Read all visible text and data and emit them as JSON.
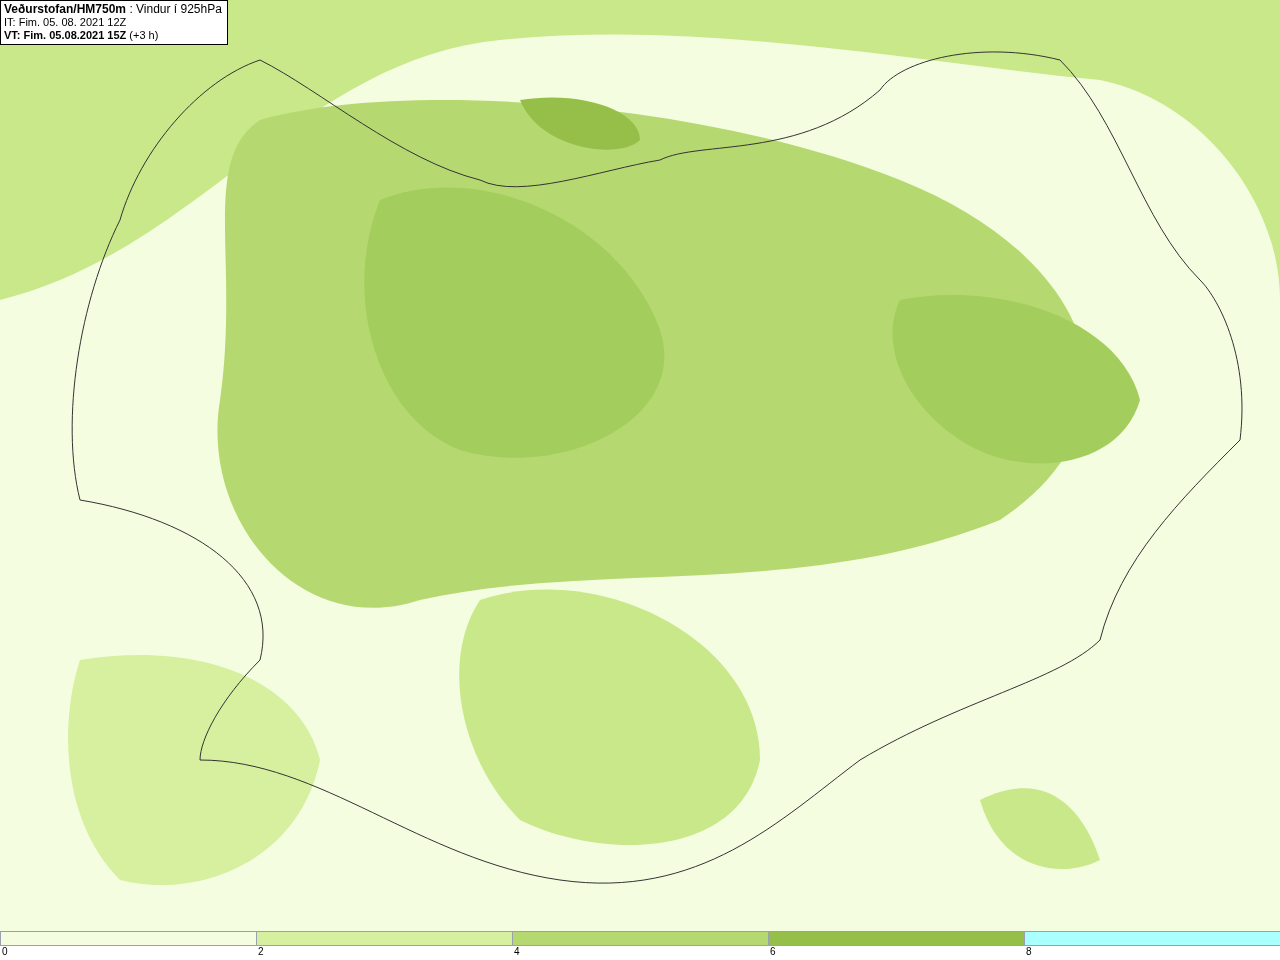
{
  "title_box": {
    "lines": [
      "**Veðurstofan/HM750m** : Vindur í 925hPa",
      "IT: Fim. 05. 08. 2021 12Z",
      "**VT: Fim. 05.08.2021 15Z** (+3 h)"
    ]
  },
  "legend": {
    "bins": [
      {
        "color": "#f5fde0"
      },
      {
        "color": "#d6f0a0"
      },
      {
        "color": "#b5d970"
      },
      {
        "color": "#95bf48"
      },
      {
        "color": "#aaffff"
      }
    ],
    "ticks": [
      "0",
      "2",
      "4",
      "6",
      "8"
    ]
  }
}
